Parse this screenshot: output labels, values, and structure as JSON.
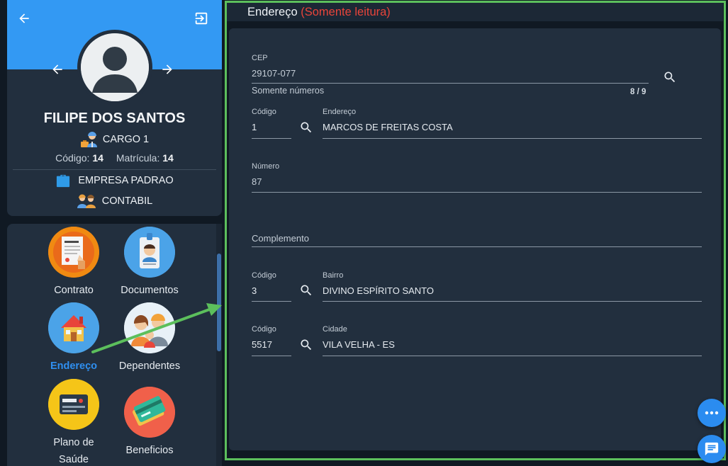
{
  "profile": {
    "name": "FILIPE DOS SANTOS",
    "role": "CARGO 1",
    "codigo_label": "Código:",
    "codigo_value": "14",
    "matricula_label": "Matrícula:",
    "matricula_value": "14",
    "company": "EMPRESA PADRAO",
    "department": "CONTABIL"
  },
  "menu": {
    "items": [
      {
        "label": "Contrato"
      },
      {
        "label": "Documentos"
      },
      {
        "label": "Endereço"
      },
      {
        "label": "Dependentes"
      },
      {
        "label_line1": "Plano de",
        "label_line2": "Saúde"
      },
      {
        "label": "Beneficios"
      }
    ]
  },
  "section": {
    "title": "Endereço",
    "readonly_note": "(Somente leitura)"
  },
  "form": {
    "cep": {
      "label": "CEP",
      "value": "29107-077",
      "hint": "Somente números",
      "counter": "8 / 9"
    },
    "logradouro": {
      "code_label": "Código",
      "code_value": "1",
      "label": "Endereço",
      "value": "MARCOS DE FREITAS COSTA"
    },
    "numero": {
      "label": "Número",
      "value": "87"
    },
    "complemento": {
      "placeholder": "Complemento"
    },
    "bairro": {
      "code_label": "Código",
      "code_value": "3",
      "label": "Bairro",
      "value": "DIVINO ESPÍRITO SANTO"
    },
    "cidade": {
      "code_label": "Código",
      "code_value": "5517",
      "label": "Cidade",
      "value": "VILA VELHA - ES"
    }
  },
  "colors": {
    "accent": "#3399f3",
    "readonly": "#e8443a",
    "highlight_frame": "#5cbf5c",
    "card": "#222f3e"
  },
  "icons": [
    "arrow-left-icon",
    "logout-icon",
    "arrow-right-icon",
    "person-icon",
    "worker-icon",
    "briefcase-icon",
    "people-icon",
    "contract-icon",
    "id-badge-icon",
    "house-icon",
    "family-icon",
    "health-card-icon",
    "cards-icon",
    "search-icon",
    "more-icon",
    "chat-icon"
  ]
}
